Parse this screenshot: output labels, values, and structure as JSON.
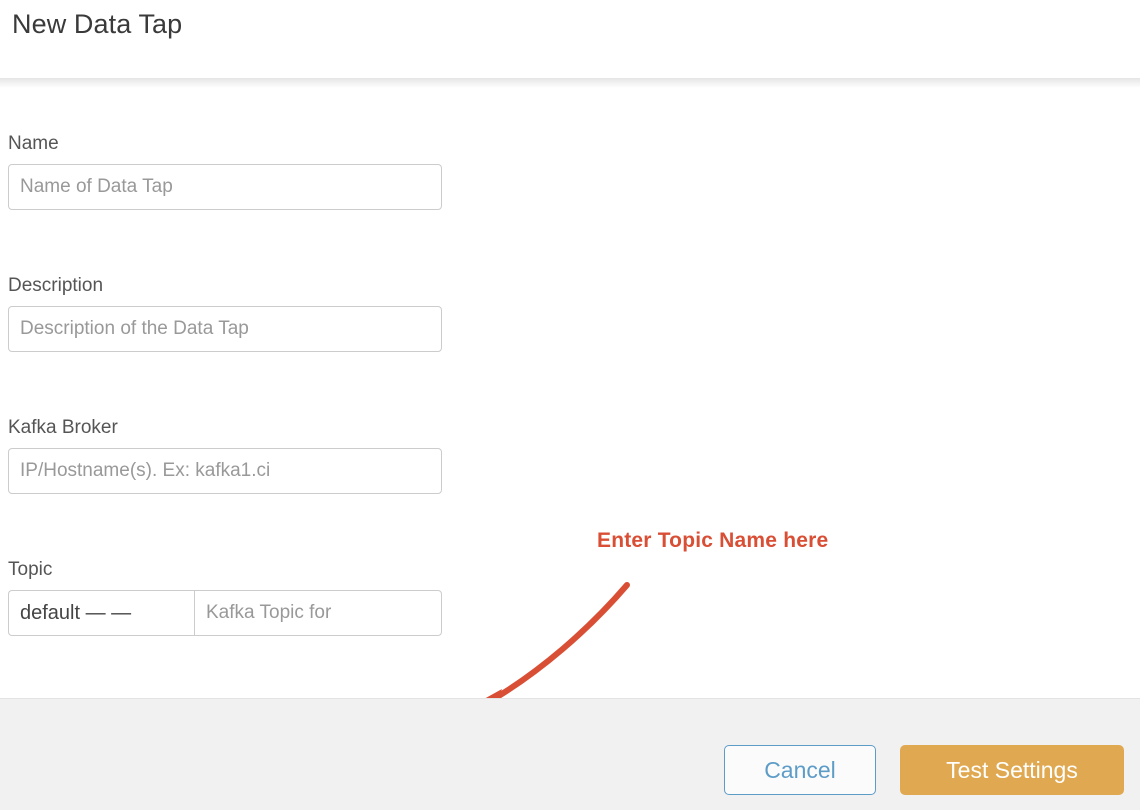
{
  "header": {
    "title": "New Data Tap"
  },
  "form": {
    "fields": [
      {
        "label": "Name",
        "placeholder": "Name of Data Tap",
        "value": ""
      },
      {
        "label": "Description",
        "placeholder": "Description of the Data Tap",
        "value": ""
      },
      {
        "label": "Kafka Broker",
        "placeholder": "IP/Hostname(s). Ex: kafka1.ci",
        "value": ""
      },
      {
        "label": "Topic",
        "prefix": "default — —",
        "placeholder": "Kafka Topic for",
        "value": ""
      }
    ]
  },
  "annotation": {
    "text": "Enter Topic Name here",
    "color": "#d94f35"
  },
  "footer": {
    "cancel_label": "Cancel",
    "test_settings_label": "Test Settings",
    "cancel_color": "#5e9cc8",
    "primary_color": "#e0a951"
  }
}
